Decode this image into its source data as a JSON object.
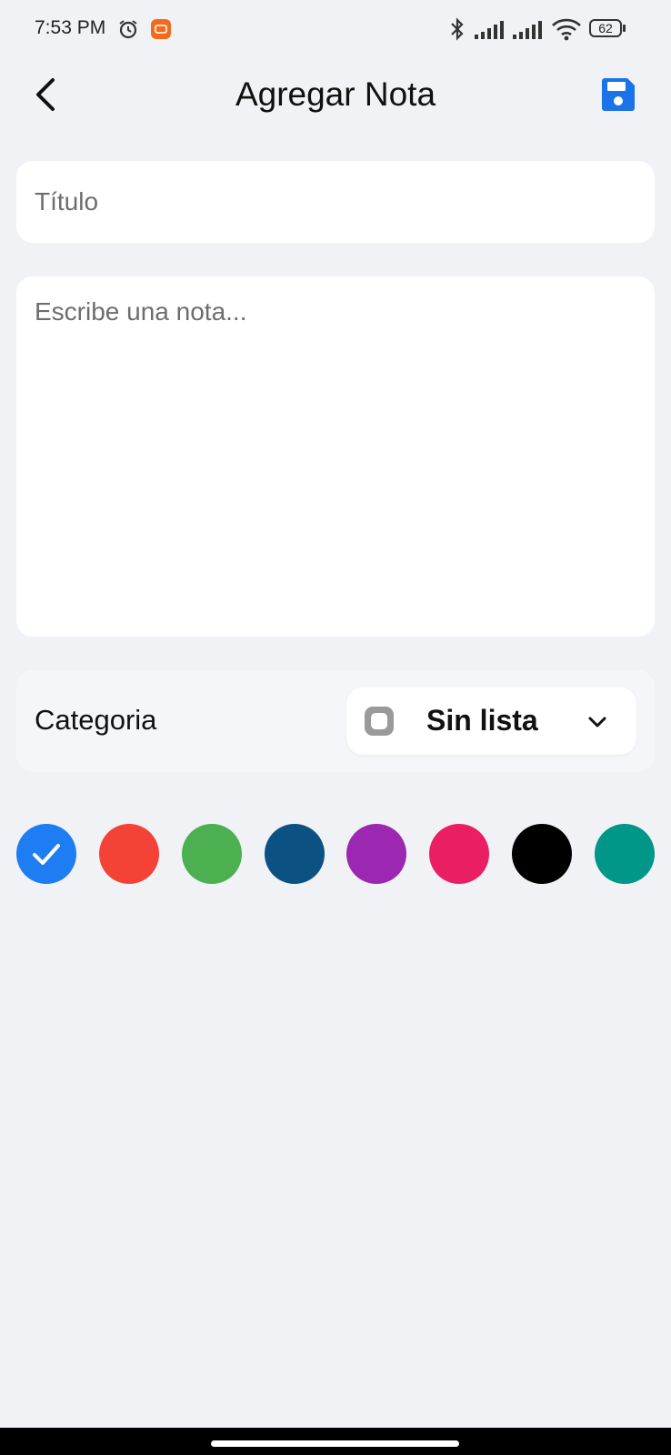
{
  "status_bar": {
    "time": "7:53 PM",
    "battery": "62",
    "icons": [
      "alarm-icon",
      "mi-app-icon",
      "bluetooth-icon",
      "signal-icon",
      "signal-icon",
      "wifi-icon",
      "battery-icon"
    ]
  },
  "header": {
    "title": "Agregar Nota",
    "back_icon": "chevron-left-icon",
    "save_icon": "floppy-disk-icon",
    "accent_color": "#1a73e8"
  },
  "form": {
    "title_placeholder": "Título",
    "title_value": "",
    "note_placeholder": "Escribe una nota...",
    "note_value": ""
  },
  "category": {
    "label": "Categoria",
    "selected": "Sin lista",
    "dropdown_icon": "chevron-down-icon"
  },
  "colors": {
    "options": [
      "#1e7df2",
      "#f44336",
      "#4caf50",
      "#0b5182",
      "#9c27b0",
      "#e91e63",
      "#000000",
      "#009688"
    ],
    "selected_index": 0
  }
}
